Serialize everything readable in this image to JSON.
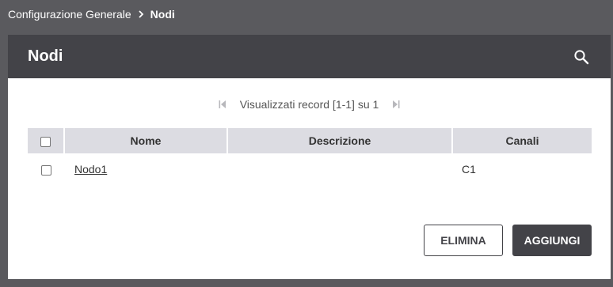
{
  "breadcrumb": {
    "parent": "Configurazione Generale",
    "current": "Nodi"
  },
  "panel": {
    "title": "Nodi"
  },
  "pager": {
    "label": "Visualizzati record [1-1] su 1"
  },
  "table": {
    "headers": [
      "Nome",
      "Descrizione",
      "Canali"
    ],
    "rows": [
      {
        "nome": "Nodo1",
        "descrizione": "",
        "canali": "C1"
      }
    ]
  },
  "buttons": {
    "delete": "ELIMINA",
    "add": "AGGIUNGI"
  },
  "icons": {
    "breadcrumb_separator": "chevron-right-icon",
    "search": "search-icon",
    "first_page": "first-page-icon",
    "last_page": "last-page-icon"
  },
  "colors": {
    "background": "#5a5a5e",
    "header": "#434348",
    "table_header": "#dcdce2"
  }
}
